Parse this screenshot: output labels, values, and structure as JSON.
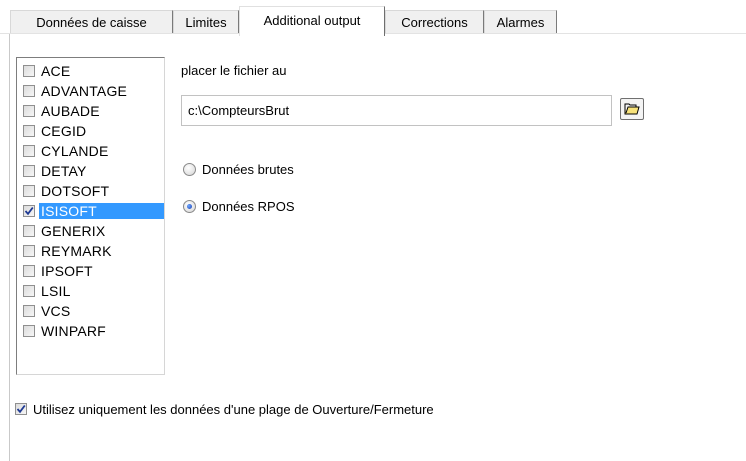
{
  "tabs": [
    {
      "label": "Données de caisse",
      "active": false
    },
    {
      "label": "Limites",
      "active": false
    },
    {
      "label": "Additional output",
      "active": true
    },
    {
      "label": "Corrections",
      "active": false
    },
    {
      "label": "Alarmes",
      "active": false
    }
  ],
  "output_list": {
    "items": [
      {
        "label": "ACE",
        "checked": false,
        "selected": false
      },
      {
        "label": "ADVANTAGE",
        "checked": false,
        "selected": false
      },
      {
        "label": "AUBADE",
        "checked": false,
        "selected": false
      },
      {
        "label": "CEGID",
        "checked": false,
        "selected": false
      },
      {
        "label": "CYLANDE",
        "checked": false,
        "selected": false
      },
      {
        "label": "DETAY",
        "checked": false,
        "selected": false
      },
      {
        "label": "DOTSOFT",
        "checked": false,
        "selected": false
      },
      {
        "label": "ISISOFT",
        "checked": true,
        "selected": true
      },
      {
        "label": "GENERIX",
        "checked": false,
        "selected": false
      },
      {
        "label": "REYMARK",
        "checked": false,
        "selected": false
      },
      {
        "label": "IPSOFT",
        "checked": false,
        "selected": false
      },
      {
        "label": "LSIL",
        "checked": false,
        "selected": false
      },
      {
        "label": "VCS",
        "checked": false,
        "selected": false
      },
      {
        "label": "WINPARF",
        "checked": false,
        "selected": false
      }
    ]
  },
  "file_location": {
    "label": "placer le fichier au",
    "value": "c:\\CompteursBrut"
  },
  "data_mode": {
    "options": [
      {
        "label": "Données brutes",
        "selected": false
      },
      {
        "label": "Données RPOS",
        "selected": true
      }
    ]
  },
  "open_close_range": {
    "label": "Utilisez uniquement les données d'une plage de Ouverture/Fermeture",
    "checked": true
  },
  "colors": {
    "selection": "#3399ff",
    "check_mark": "#1f3a93"
  }
}
